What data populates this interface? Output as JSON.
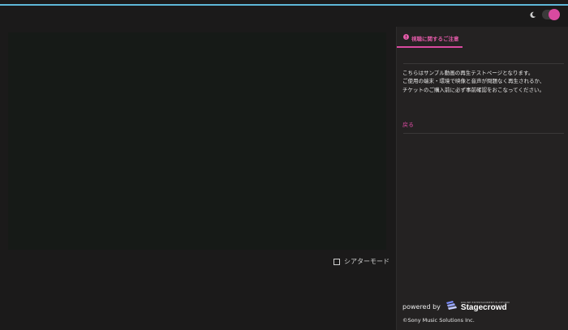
{
  "header": {
    "theme_icon": "moon-icon",
    "toggle_color": "#d94aa0",
    "accent_line_color": "#5eb7d8"
  },
  "player": {
    "theater_mode_label": "シアターモード",
    "theater_icon": "fullscreen-corners-icon"
  },
  "sidebar": {
    "tab": {
      "icon": "info-icon",
      "label": "視聴に関するご注意"
    },
    "notice_lines": [
      "こちらはサンプル動画の再生テストページとなります。",
      "ご使用の端末・環境で映像と音声が問題なく再生されるか、",
      "チケットのご購入前に必ず事前確認をおこなってください。"
    ],
    "back_link": "戻る",
    "powered_by": "powered by",
    "brand": {
      "tagline": "ONLINE ENTERTAINMENT PLATFORM",
      "name": "Stagecrowd"
    },
    "copyright": "©Sony Music Solutions Inc."
  },
  "colors": {
    "accent": "#d94aa0",
    "background": "#1b1a1a",
    "sidebar_bg": "#242222",
    "player_bg": "#161a17"
  }
}
